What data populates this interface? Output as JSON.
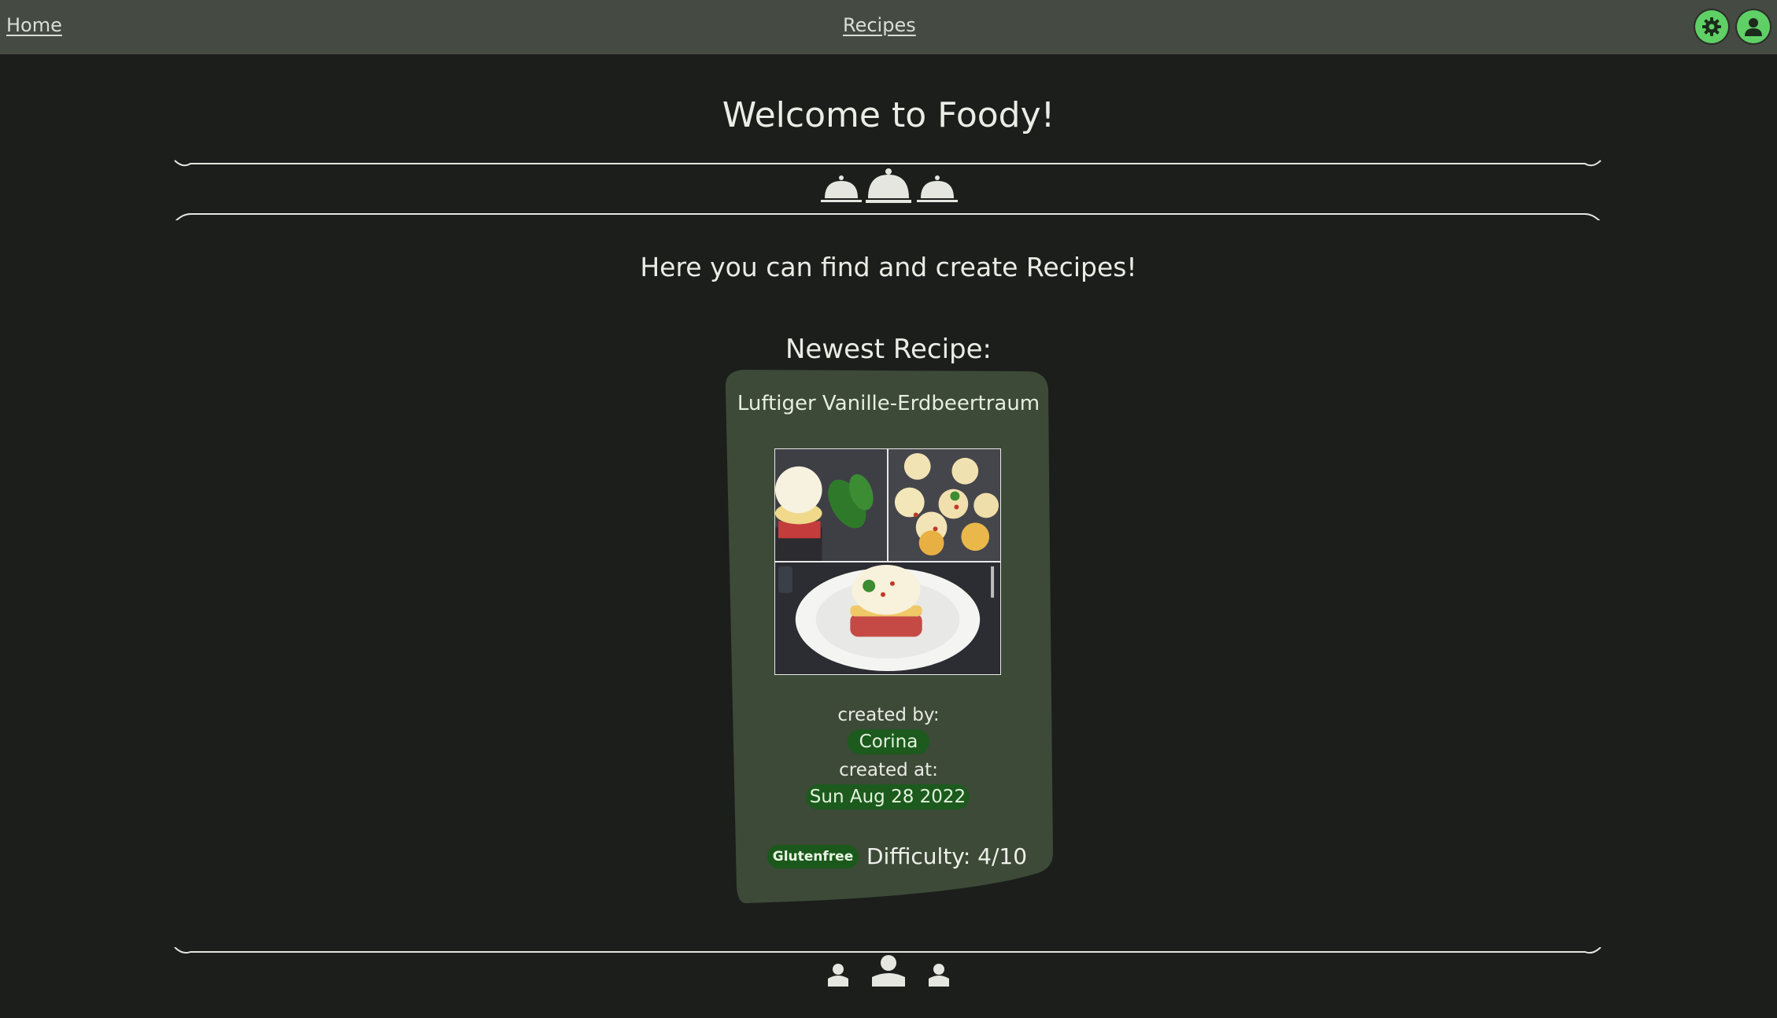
{
  "nav": {
    "home": "Home",
    "recipes": "Recipes"
  },
  "header": {
    "settings_icon": "gear-icon",
    "profile_icon": "user-icon"
  },
  "main": {
    "title": "Welcome to Foody!",
    "subtitle": "Here you can find and create Recipes!",
    "section_title": "Newest Recipe:"
  },
  "recipe": {
    "name": "Luftiger Vanille-Erdbeertraum",
    "created_by_label": "created by:",
    "author": "Corina",
    "created_at_label": "created at:",
    "date": "Sun Aug 28 2022",
    "tag": "Glutenfree",
    "difficulty": "Difficulty: 4/10"
  },
  "colors": {
    "background": "#1c1e1b",
    "topbar": "#454b43",
    "card": "#3c4a37",
    "accent": "#5fd065",
    "pill": "#1c5a1e"
  }
}
